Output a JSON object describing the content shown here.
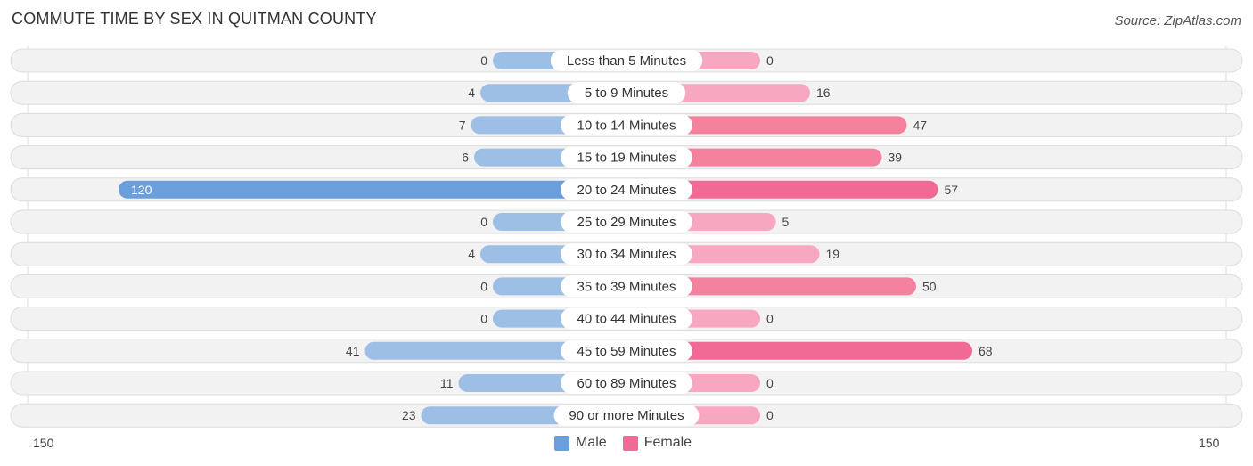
{
  "header": {
    "title": "COMMUTE TIME BY SEX IN QUITMAN COUNTY",
    "source": "Source: ZipAtlas.com"
  },
  "colors": {
    "male": "#9dbfe6",
    "male_strong": "#6a9fdc",
    "female": "#f7a7c0",
    "female_strong": "#f06a95",
    "row_bg": "#f2f2f2"
  },
  "chart_data": {
    "type": "bar",
    "title": "COMMUTE TIME BY SEX IN QUITMAN COUNTY",
    "categories": [
      "Less than 5 Minutes",
      "5 to 9 Minutes",
      "10 to 14 Minutes",
      "15 to 19 Minutes",
      "20 to 24 Minutes",
      "25 to 29 Minutes",
      "30 to 34 Minutes",
      "35 to 39 Minutes",
      "40 to 44 Minutes",
      "45 to 59 Minutes",
      "60 to 89 Minutes",
      "90 or more Minutes"
    ],
    "series": [
      {
        "name": "Male",
        "values": [
          0,
          4,
          7,
          6,
          120,
          0,
          4,
          0,
          0,
          41,
          11,
          23
        ]
      },
      {
        "name": "Female",
        "values": [
          0,
          16,
          47,
          39,
          57,
          5,
          19,
          50,
          0,
          68,
          0,
          0
        ]
      }
    ],
    "xlim": [
      -150,
      150
    ],
    "axis_labels": {
      "left": "150",
      "right": "150"
    },
    "legend": {
      "position": "bottom-center",
      "entries": [
        "Male",
        "Female"
      ]
    }
  }
}
